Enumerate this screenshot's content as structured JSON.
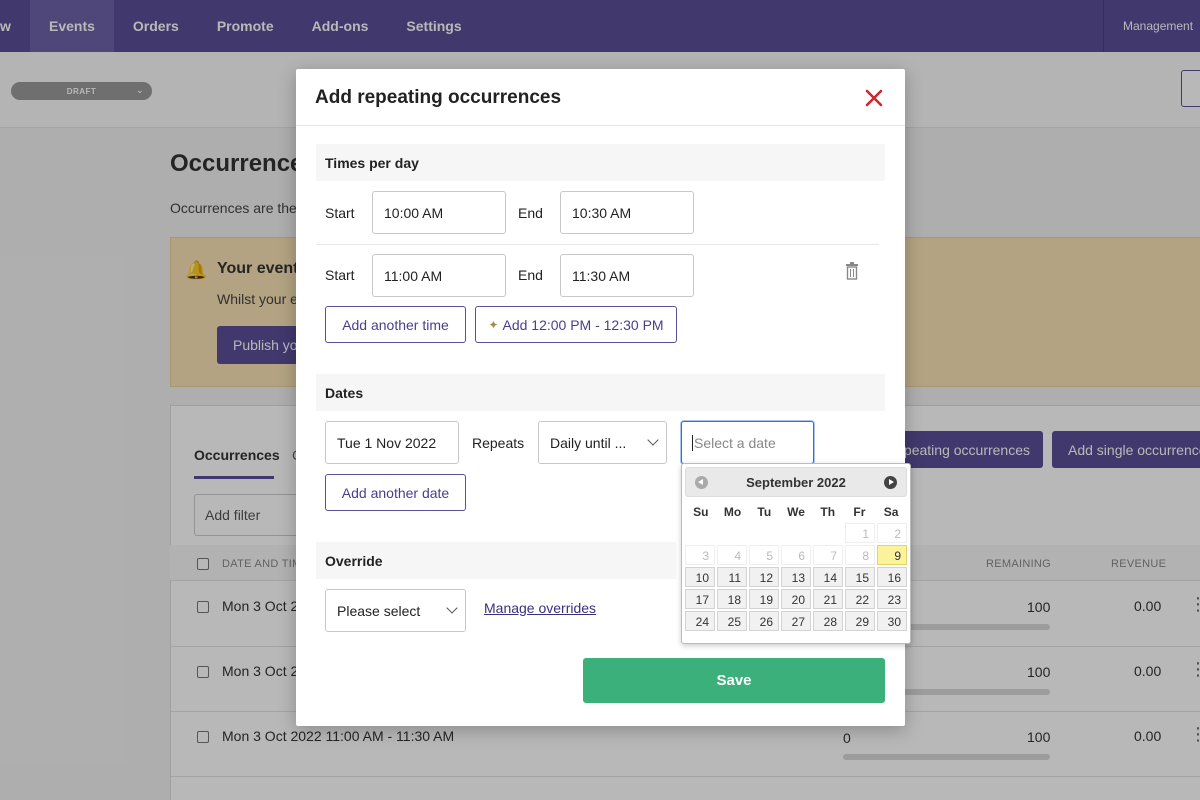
{
  "nav": {
    "items": [
      "w",
      "Events",
      "Orders",
      "Promote",
      "Add-ons",
      "Settings"
    ],
    "active": 1,
    "management": "Management"
  },
  "status_pill": "DRAFT",
  "background": {
    "title": "Occurrence",
    "description": "Occurrences are the",
    "notice_title": "Your event",
    "notice_text": "Whilst your e",
    "publish_label": "Publish yo",
    "tabs": [
      "Occurrences",
      "C"
    ],
    "filter_placeholder": "Add filter",
    "add_repeating_label": "peating occurrences",
    "add_single_label": "Add single occurrence",
    "columns": [
      "DATE AND TIM",
      "REMAINING",
      "REVENUE"
    ],
    "rows": [
      {
        "date": "Mon 3 Oct 2",
        "sold": "",
        "remaining": "100",
        "revenue": "0.00"
      },
      {
        "date": "Mon 3 Oct 2",
        "sold": "",
        "remaining": "100",
        "revenue": "0.00"
      },
      {
        "date": "Mon 3 Oct 2022 11:00 AM - 11:30 AM",
        "sold": "0",
        "remaining": "100",
        "revenue": "0.00"
      }
    ]
  },
  "modal": {
    "title": "Add repeating occurrences",
    "times_section": "Times per day",
    "start_label": "Start",
    "end_label": "End",
    "times": [
      {
        "start": "10:00 AM",
        "end": "10:30 AM"
      },
      {
        "start": "11:00 AM",
        "end": "11:30 AM"
      }
    ],
    "add_time_label": "Add another time",
    "add_suggested_label": "Add 12:00 PM - 12:30 PM",
    "dates_section": "Dates",
    "start_date": "Tue 1 Nov 2022",
    "repeats_label": "Repeats",
    "repeats_value": "Daily until ...",
    "until_placeholder": "Select a date",
    "add_date_label": "Add another date",
    "override_section": "Override",
    "override_value": "Please select",
    "manage_overrides": "Manage overrides",
    "save_label": "Save"
  },
  "datepicker": {
    "month": "September 2022",
    "weekdays": [
      "Su",
      "Mo",
      "Tu",
      "We",
      "Th",
      "Fr",
      "Sa"
    ],
    "leading_blank": 5,
    "disabled_days": [
      "1",
      "2",
      "3",
      "4",
      "5",
      "6",
      "7",
      "8"
    ],
    "today": "9",
    "days": [
      "10",
      "11",
      "12",
      "13",
      "14",
      "15",
      "16",
      "17",
      "18",
      "19",
      "20",
      "21",
      "22",
      "23",
      "24",
      "25",
      "26",
      "27",
      "28",
      "29",
      "30"
    ]
  },
  "colors": {
    "brand": "#5b4f98",
    "save": "#3bb07a",
    "close": "#d0262c",
    "highlight": "#fbf39c"
  }
}
